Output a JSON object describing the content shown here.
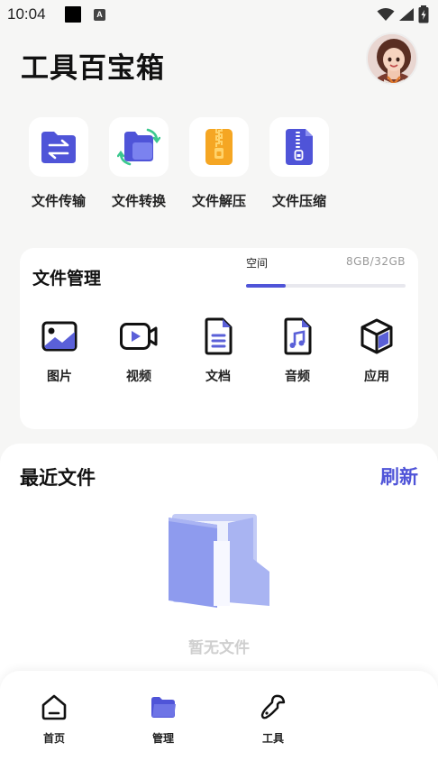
{
  "status_bar": {
    "time": "10:04",
    "a_badge": "A"
  },
  "header": {
    "title": "工具百宝箱"
  },
  "quick_tools": [
    {
      "label": "文件传输",
      "icon": "file-transfer-icon"
    },
    {
      "label": "文件转换",
      "icon": "file-convert-icon"
    },
    {
      "label": "文件解压",
      "icon": "file-unzip-icon"
    },
    {
      "label": "文件压缩",
      "icon": "file-compress-icon"
    }
  ],
  "file_management": {
    "title": "文件管理",
    "storage_label": "空间",
    "storage_value": "8GB/32GB",
    "storage_used_fraction": 0.25,
    "accent_color": "#4f54d8",
    "categories": [
      {
        "label": "图片",
        "icon": "image-icon"
      },
      {
        "label": "视频",
        "icon": "video-icon"
      },
      {
        "label": "文档",
        "icon": "document-icon"
      },
      {
        "label": "音频",
        "icon": "audio-icon"
      },
      {
        "label": "应用",
        "icon": "app-cube-icon"
      }
    ]
  },
  "recent_files": {
    "title": "最近文件",
    "refresh_label": "刷新",
    "empty_text": "暂无文件"
  },
  "bottom_nav": [
    {
      "label": "首页",
      "icon": "home-icon",
      "active": false
    },
    {
      "label": "管理",
      "icon": "folder-icon",
      "active": true
    },
    {
      "label": "工具",
      "icon": "wrench-icon",
      "active": false
    }
  ]
}
